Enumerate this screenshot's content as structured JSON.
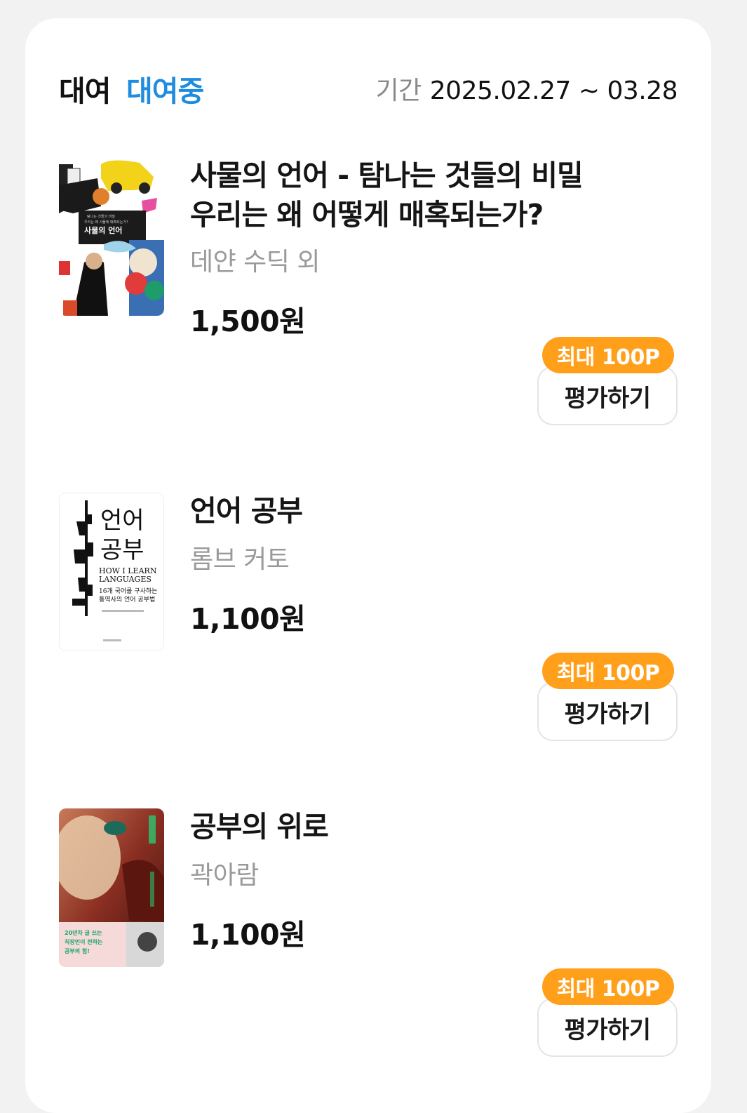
{
  "header": {
    "label": "대여",
    "status": "대여중",
    "period_label": "기간",
    "period_value": "2025.02.27 ~ 03.28"
  },
  "items": [
    {
      "title_lines": [
        "사물의 언어 - 탐나는 것들의 비밀",
        "우리는 왜 어떻게 매혹되는가?"
      ],
      "author": "데얀 수딕 외",
      "price": "1,500원",
      "badge": "최대 100P",
      "rate_label": "평가하기",
      "cover_title": "사물의 언어"
    },
    {
      "title_lines": [
        "언어 공부"
      ],
      "author": "롬브 커토",
      "price": "1,100원",
      "badge": "최대 100P",
      "rate_label": "평가하기",
      "cover_title_1": "언어",
      "cover_title_2": "공부",
      "cover_sub_1": "HOW I LEARN",
      "cover_sub_2": "LANGUAGES",
      "cover_desc_1": "16개 국어를 구사하는",
      "cover_desc_2": "통역사의 언어 공부법"
    },
    {
      "title_lines": [
        "공부의 위로"
      ],
      "author": "곽아람",
      "price": "1,100원",
      "badge": "최대 100P",
      "rate_label": "평가하기",
      "cover_tag_1": "20년차 글 쓰는",
      "cover_tag_2": "직장인이 전하는",
      "cover_tag_3": "공부의 힘!"
    }
  ],
  "colors": {
    "accent_blue": "#1f8ce0",
    "badge_orange": "#ff9f1a",
    "author_gray": "#9a9a9a"
  }
}
